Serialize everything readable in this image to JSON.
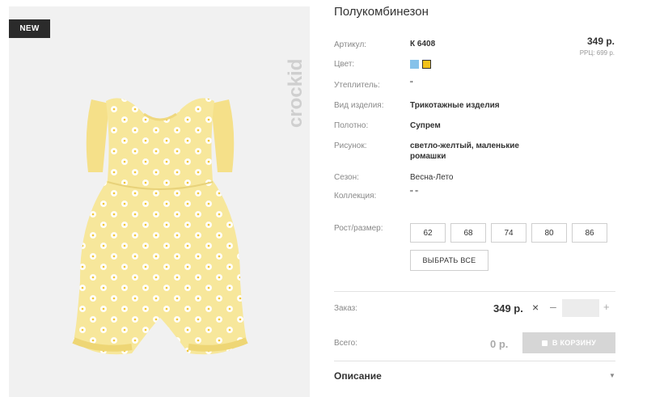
{
  "badge": "NEW",
  "brand_logo": "crockid",
  "product": {
    "title": "Полукомбинезон",
    "price": "349 р.",
    "rrp": "РРЦ: 699 р.",
    "swatch_colors": [
      "#86c2ea",
      "#f3c21b"
    ],
    "garment_color": "#f7e79b",
    "pattern_color": "#ffffff"
  },
  "specs": [
    {
      "label": "Артикул:",
      "value": "К 6408"
    },
    {
      "label": "Цвет:",
      "value": ""
    },
    {
      "label": "Утеплитель:",
      "value": "\""
    },
    {
      "label": "Вид изделия:",
      "value": "Трикотажные изделия"
    },
    {
      "label": "Полотно:",
      "value": "Супрем"
    },
    {
      "label": "Рисунок:",
      "value": "светло-желтый, маленькие ромашки"
    },
    {
      "label": "Сезон:",
      "value": "Весна-Лето"
    },
    {
      "label": "Коллекция:",
      "value": "\" \""
    },
    {
      "label": "Рост/размер:",
      "value": ""
    }
  ],
  "sizes": [
    "62",
    "68",
    "74",
    "80",
    "86"
  ],
  "select_all_label": "ВЫБРАТЬ ВСЕ",
  "order": {
    "label": "Заказ:",
    "price": "349 р.",
    "multiply": "×",
    "minus": "–",
    "plus": "+",
    "qty_value": ""
  },
  "total": {
    "label": "Всего:",
    "value": "0 р.",
    "cart_label": "В КОРЗИНУ"
  },
  "description_label": "Описание"
}
